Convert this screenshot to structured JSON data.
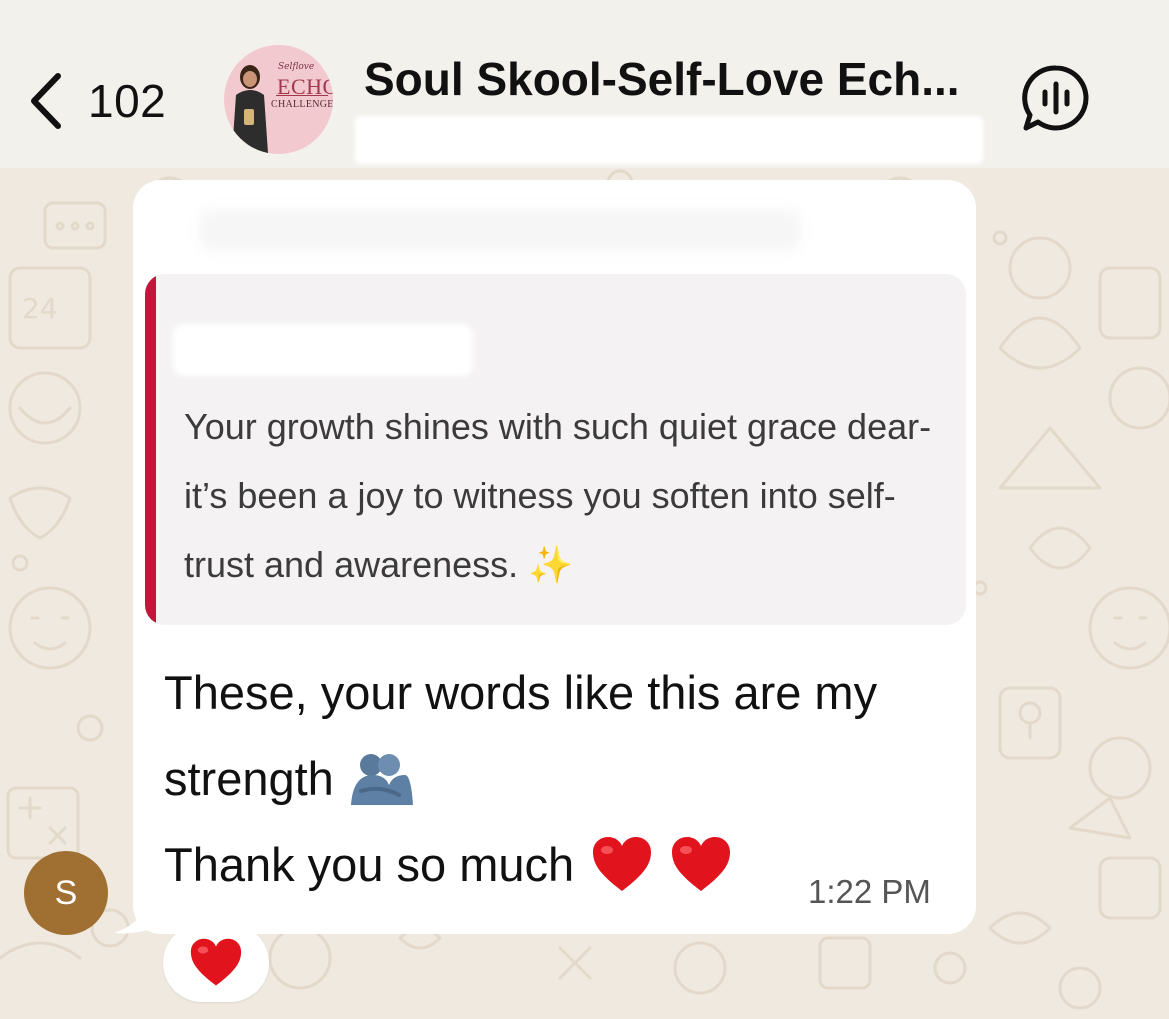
{
  "header": {
    "back_count": "102",
    "back_icon": "chevron-left-icon",
    "group_title": "Soul Skool-Self-Love Ech...",
    "avatar": {
      "script_text": "Selflove",
      "echo_text": "ECHO",
      "challenge_text": "CHALLENGE"
    },
    "voice_chat_icon": "voice-chat-icon"
  },
  "message": {
    "quote": {
      "text": "Your growth shines with such quiet grace dear-it’s been a joy to witness you soften into self-trust and awareness.",
      "emoji": "✨",
      "bar_color": "#c4153a"
    },
    "body": {
      "line1": "These, your words like this are my",
      "line2": "strength",
      "line3": "Thank you so much",
      "hug_emoji": "hug-icon",
      "heart_emoji": "red-heart-icon"
    },
    "time": "1:22 PM",
    "reaction": "❤️"
  },
  "sender": {
    "initial": "S",
    "color": "#a07032"
  }
}
